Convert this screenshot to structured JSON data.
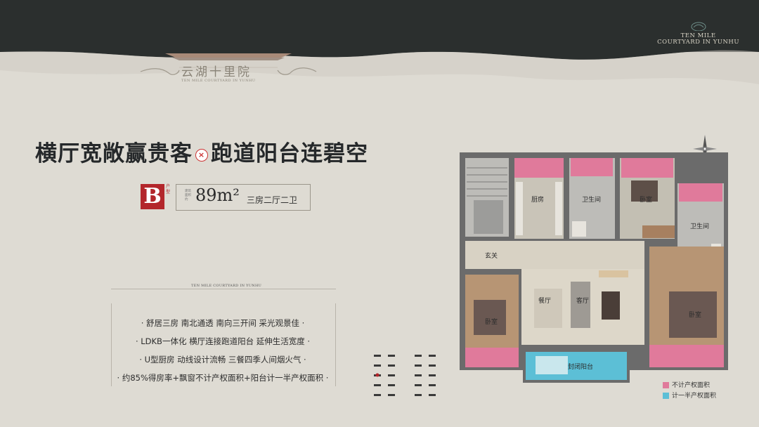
{
  "brand": {
    "name_cn": "云湖十里院",
    "name_en": "TEN MILE COURTYARD IN YUNHU",
    "corner_en_line1": "TEN MILE",
    "corner_en_line2": "COURTYARD IN YUNHU"
  },
  "headline": {
    "part1": "横厅宽敞赢贵客",
    "separator": "×",
    "part2": "跑道阳台连碧空"
  },
  "unit": {
    "type_letter": "B",
    "type_suffix": "户型",
    "area_caption": "建筑面积约",
    "area": "89m²",
    "layout": "三房二厅二卫"
  },
  "tagline": "TEN MILE COURTYARD IN YUNHU",
  "features": [
    "· 舒居三房 南北通透 南向三开间 采光观景佳 ·",
    "· LDKB一体化 横厅连接跑道阳台 延伸生活宽度 ·",
    "· U型厨房 动线设计流畅 三餐四季人间烟火气 ·",
    "· 约85%得房率+飘窗不计产权面积+阳台计一半产权面积 ·"
  ],
  "rooms": {
    "kitchen": "厨房",
    "bath1": "卫生间",
    "bath2": "卫生间",
    "bedroom_n": "卧室",
    "foyer": "玄关",
    "dining": "餐厅",
    "living": "客厅",
    "bedroom_sw": "卧室",
    "bedroom_se": "卧室",
    "balcony": "封闭阳台"
  },
  "legend": [
    {
      "label": "不计产权面积",
      "color": "#e07a9b"
    },
    {
      "label": "计一半产权面积",
      "color": "#5cbfd6"
    }
  ],
  "colors": {
    "accent_red": "#b3262b",
    "top_bar": "#2b2f2e",
    "background": "#dedbd3"
  }
}
